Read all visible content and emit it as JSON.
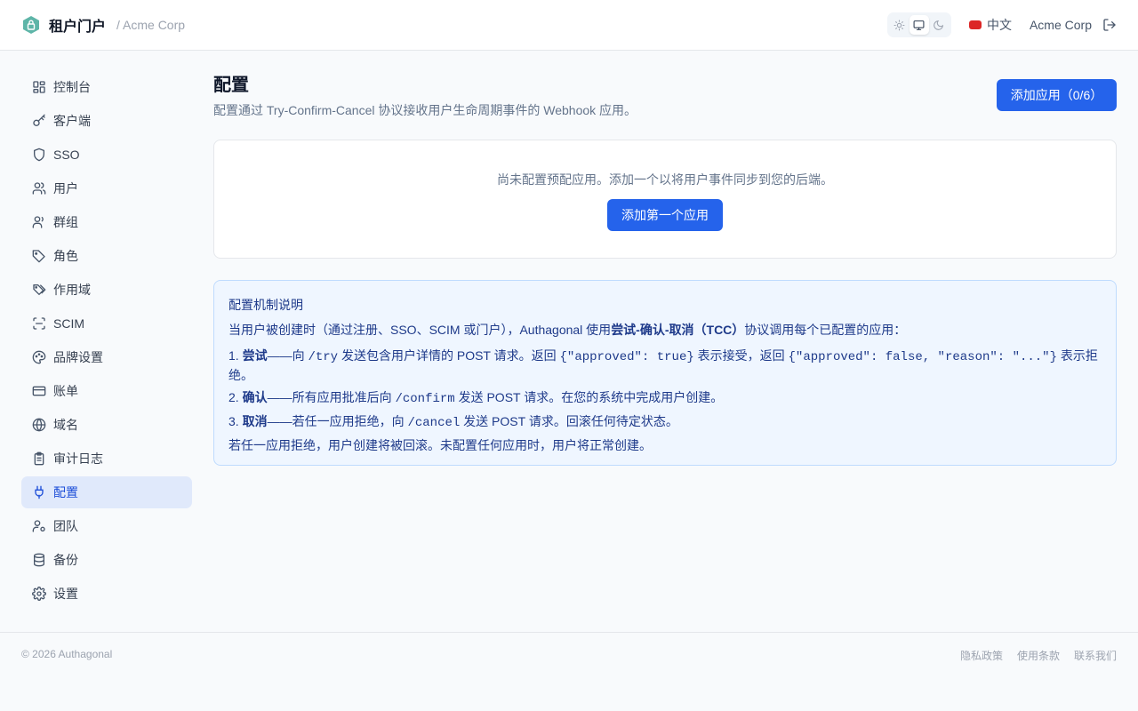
{
  "header": {
    "title": "租户门户",
    "subtitle": "/ Acme Corp",
    "language": "中文",
    "tenant": "Acme Corp",
    "theme_modes": [
      "light",
      "system",
      "dark"
    ],
    "active_theme": "system"
  },
  "sidebar": {
    "items": [
      {
        "label": "控制台",
        "icon": "dashboard-icon",
        "active": false
      },
      {
        "label": "客户端",
        "icon": "key-icon",
        "active": false
      },
      {
        "label": "SSO",
        "icon": "shield-icon",
        "active": false
      },
      {
        "label": "用户",
        "icon": "users-icon",
        "active": false
      },
      {
        "label": "群组",
        "icon": "group-icon",
        "active": false
      },
      {
        "label": "角色",
        "icon": "tag-icon",
        "active": false
      },
      {
        "label": "作用域",
        "icon": "tags-icon",
        "active": false
      },
      {
        "label": "SCIM",
        "icon": "scan-icon",
        "active": false
      },
      {
        "label": "品牌设置",
        "icon": "palette-icon",
        "active": false
      },
      {
        "label": "账单",
        "icon": "credit-card-icon",
        "active": false
      },
      {
        "label": "域名",
        "icon": "globe-icon",
        "active": false
      },
      {
        "label": "审计日志",
        "icon": "clipboard-icon",
        "active": false
      },
      {
        "label": "配置",
        "icon": "plug-icon",
        "active": true
      },
      {
        "label": "团队",
        "icon": "user-team-icon",
        "active": false
      },
      {
        "label": "备份",
        "icon": "database-icon",
        "active": false
      },
      {
        "label": "设置",
        "icon": "gear-icon",
        "active": false
      }
    ]
  },
  "main": {
    "title": "配置",
    "description": "配置通过 Try-Confirm-Cancel 协议接收用户生命周期事件的 Webhook 应用。",
    "add_button": "添加应用（0/6）",
    "empty_text": "尚未配置预配应用。添加一个以将用户事件同步到您的后端。",
    "first_button": "添加第一个应用"
  },
  "info": {
    "title": "配置机制说明",
    "intro_before": "当用户被创建时（通过注册、SSO、SCIM 或门户），Authagonal 使用",
    "intro_bold": "尝试-确认-取消（TCC）",
    "intro_after": "协议调用每个已配置的应用：",
    "step1_num": "1. ",
    "step1_bold": "尝试",
    "step1_a": "——向 ",
    "step1_code1": "/try",
    "step1_b": " 发送包含用户详情的 POST 请求。返回 ",
    "step1_code2": "{\"approved\": true}",
    "step1_c": " 表示接受，返回 ",
    "step1_code3": "{\"approved\": false, \"reason\": \"...\"}",
    "step1_d": " 表示拒绝。",
    "step2_num": "2. ",
    "step2_bold": "确认",
    "step2_a": "——所有应用批准后向 ",
    "step2_code": "/confirm",
    "step2_b": " 发送 POST 请求。在您的系统中完成用户创建。",
    "step3_num": "3. ",
    "step3_bold": "取消",
    "step3_a": "——若任一应用拒绝，向 ",
    "step3_code": "/cancel",
    "step3_b": " 发送 POST 请求。回滚任何待定状态。",
    "footer": "若任一应用拒绝，用户创建将被回滚。未配置任何应用时，用户将正常创建。"
  },
  "footer": {
    "copyright": "© 2026 Authagonal",
    "links": [
      "隐私政策",
      "使用条款",
      "联系我们"
    ]
  },
  "colors": {
    "accent": "#2563eb",
    "active_nav_bg": "#e0e9fb",
    "info_bg": "#eff6ff",
    "info_text": "#1e3a8a"
  }
}
